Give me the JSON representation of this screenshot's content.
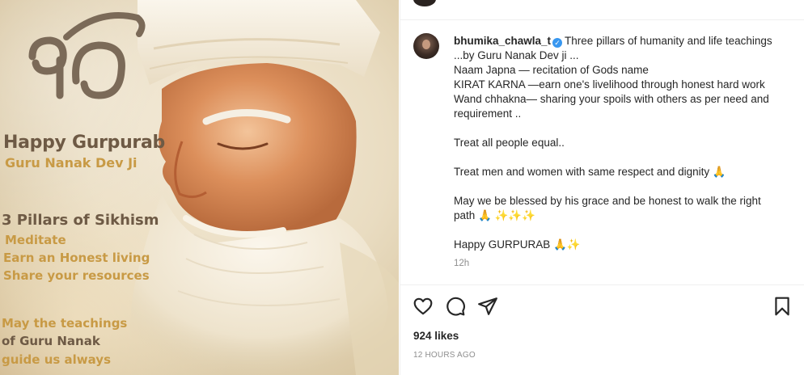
{
  "image": {
    "emblem": "ik-onkar-symbol",
    "heading": "Happy Gurpurab",
    "subheading": "Guru Nanak Dev Ji",
    "pillars_title": "3 Pillars of Sikhism",
    "pillar_1": "Meditate",
    "pillar_2": "Earn an Honest living",
    "pillar_3": "Share your resources",
    "wish_line_1": "May the teachings",
    "wish_line_2_prefix": "of ",
    "wish_line_2_name": "Guru Nanak",
    "wish_line_3": "guide us always"
  },
  "post": {
    "username": "bhumika_chawla_t",
    "verified_icon": "verified-badge-icon",
    "verified_glyph": "✓",
    "caption_lines": [
      "Three pillars of humanity and life teachings",
      "...by Guru Nanak Dev ji ...",
      "Naam Japna — recitation of Gods name",
      "KIRAT KARNA —earn one's livelihood through honest hard work",
      "Wand chhakna— sharing your spoils with others as per need and",
      "requirement ..",
      "Treat all people equal..",
      "Treat men and women with same respect and dignity 🙏",
      "May we be blessed by his grace and be honest to walk the right",
      "path 🙏 ✨✨✨",
      "Happy GURPURAB 🙏✨"
    ],
    "comment_age": "12h",
    "likes": "924 likes",
    "posted": "12 HOURS AGO"
  },
  "actions": {
    "like_icon": "heart-icon",
    "comment_icon": "comment-icon",
    "share_icon": "share-icon",
    "save_icon": "bookmark-icon"
  },
  "colors": {
    "accent_verified": "#3897f0",
    "text_primary": "#262626",
    "text_secondary": "#8e8e8e",
    "image_brown": "#6e5a45",
    "image_gold": "#c89a45"
  }
}
